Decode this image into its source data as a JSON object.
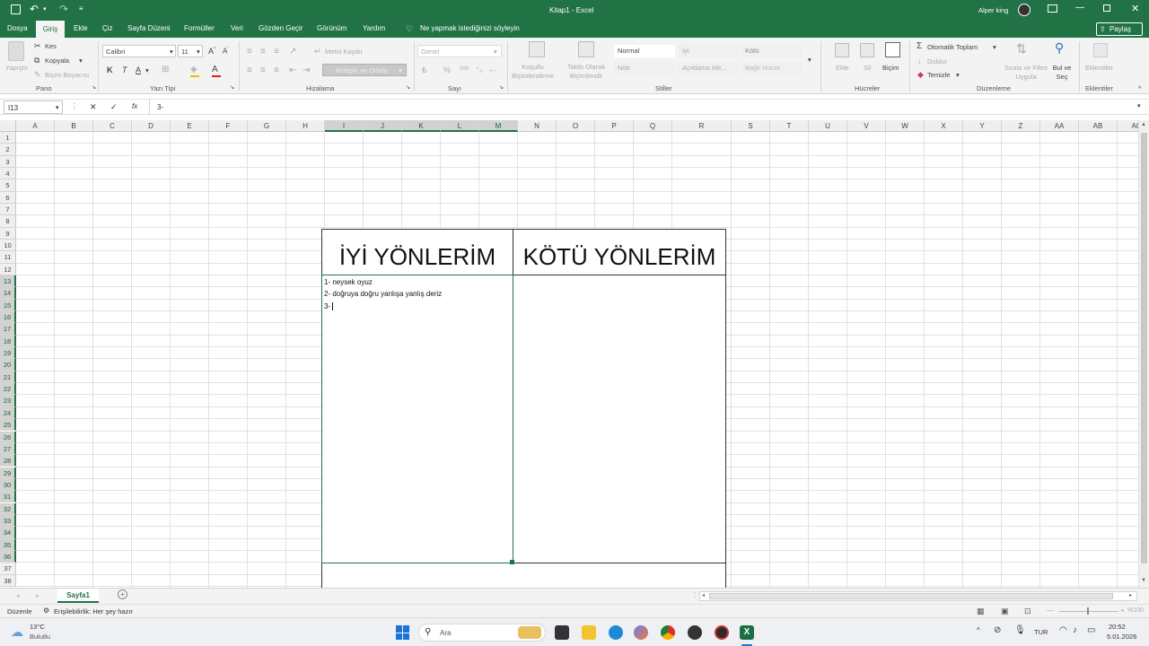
{
  "window": {
    "title": "Kitap1  -  Excel",
    "user": "Alper king"
  },
  "colors": {
    "accent": "#217346",
    "ribbon_bg": "#f3f3f3",
    "selection": "#217346"
  },
  "menu": {
    "items": [
      "Dosya",
      "Giriş",
      "Ekle",
      "Çiz",
      "Sayfa Düzeni",
      "Formüller",
      "Veri",
      "Gözden Geçir",
      "Görünüm",
      "Yardım"
    ],
    "active": "Giriş",
    "tell_me": "Ne yapmak istediğinizi söyleyin",
    "share": "Paylaş"
  },
  "ribbon": {
    "clipboard": {
      "label": "Pano",
      "paste": "Yapıştır",
      "cut": "Kes",
      "copy": "Kopyala",
      "format_painter": "Biçim Boyacısı"
    },
    "font": {
      "label": "Yazı Tipi",
      "font_name": "Calibri",
      "font_size": "11",
      "bold": "K",
      "italic": "T",
      "underline": "A"
    },
    "alignment": {
      "label": "Hizalama",
      "wrap": "Metni Kaydır",
      "merge": "Birleştir ve Ortala"
    },
    "number": {
      "label": "Sayı",
      "format": "Genel",
      "percent": "%",
      "comma": "000"
    },
    "styles": {
      "label": "Stiller",
      "conditional": "Koşullu\nBiçimlendirme",
      "table": "Tablo Olarak\nBiçimlendir",
      "cells": [
        "Normal",
        "İyi",
        "Kötü",
        "Nötr",
        "Açıklama Me...",
        "Bağlı Hücre"
      ]
    },
    "cells_group": {
      "label": "Hücreler",
      "insert": "Ekle",
      "delete": "Sil",
      "format": "Biçim"
    },
    "editing": {
      "label": "Düzenleme",
      "autosum": "Otomatik Toplam",
      "fill": "Doldur",
      "clear": "Temizle",
      "sort": "Sırala ve Filtre Uygula",
      "find": "Bul ve Seç"
    },
    "addins": {
      "label": "Eklentiler",
      "addins": "Eklentiler"
    }
  },
  "formula_bar": {
    "name_box": "I13",
    "content": "3-",
    "cancel": "✕",
    "enter": "✓",
    "fx": "fx"
  },
  "grid": {
    "columns": [
      "A",
      "B",
      "C",
      "D",
      "E",
      "F",
      "G",
      "H",
      "I",
      "J",
      "K",
      "L",
      "M",
      "N",
      "O",
      "P",
      "Q",
      "R",
      "S",
      "T",
      "U",
      "V",
      "W",
      "X",
      "Y",
      "Z",
      "AA",
      "AB",
      "AC"
    ],
    "rows": [
      1,
      2,
      3,
      4,
      5,
      6,
      7,
      8,
      9,
      10,
      11,
      12,
      13,
      14,
      15,
      16,
      17,
      18,
      19,
      20,
      21,
      22,
      23,
      24,
      25,
      26,
      27,
      28,
      29,
      30,
      31,
      32,
      33,
      34,
      35,
      36,
      37,
      38
    ]
  },
  "table": {
    "header_left": "İYİ YÖNLERİM",
    "header_right": "KÖTÜ YÖNLERİM",
    "lines": [
      "1- neysek oyuz",
      "2- doğruya doğru yanlışa  yanlış deriz",
      "3-"
    ]
  },
  "sheets": {
    "tabs": [
      "Sayfa1"
    ],
    "add": "+"
  },
  "status": {
    "mode": "Düzenle",
    "accessibility": "Erişilebilirlik: Her şey hazır",
    "zoom": "%100"
  },
  "taskbar": {
    "weather_temp": "13°C",
    "weather_text": "Bulutlu",
    "search": "Ara",
    "lang": "TUR",
    "time": "20:52",
    "date": "5.01.2026"
  }
}
